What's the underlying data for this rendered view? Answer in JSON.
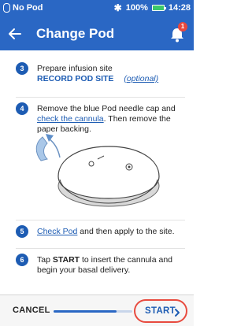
{
  "status_bar": {
    "pod_status": "No Pod",
    "battery": "100%",
    "time": "14:28",
    "battery_color": "#3cc86b"
  },
  "header": {
    "title": "Change Pod",
    "notification_count": "1",
    "background": "#2a67c4"
  },
  "steps": [
    {
      "number": "3",
      "text": "Prepare infusion site",
      "record_label": "RECORD POD SITE",
      "optional_label": "(optional)"
    },
    {
      "number": "4",
      "text_prefix": "Remove the blue Pod needle cap and ",
      "link": "check the cannula",
      "text_suffix": ". Then remove the paper backing."
    },
    {
      "number": "5",
      "link": "Check Pod",
      "text_suffix": " and then apply to the site."
    },
    {
      "number": "6",
      "text_prefix": "Tap ",
      "bold": "START",
      "text_suffix": " to insert the cannula and begin your basal delivery."
    }
  ],
  "footer": {
    "cancel_label": "CANCEL",
    "start_label": "START",
    "progress_fraction": 0.8,
    "highlight_color": "#e84b3f"
  }
}
